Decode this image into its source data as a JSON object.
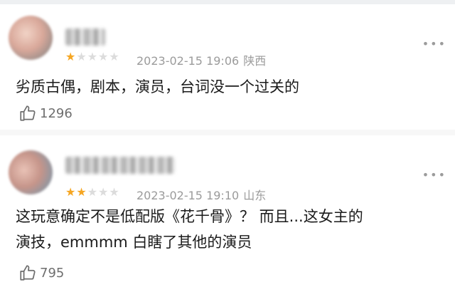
{
  "comments": [
    {
      "username": "",
      "username_fragment": "Ⅰ",
      "rating": 1,
      "max_rating": 5,
      "date": "2023-02-15 19:06",
      "location": "陕西",
      "content_line1": "劣质古偶，剧本，演员，台词没一个过关的",
      "content_line2": "",
      "likes": "1296",
      "more_label": "•••"
    },
    {
      "username": "",
      "rating": 2,
      "max_rating": 5,
      "date": "2023-02-15 19:10",
      "location": "山东",
      "content_line1": "这玩意确定不是低配版《花千骨》？ 而且...这女主的",
      "content_line2": "演技，emmmm 白瞎了其他的演员",
      "likes": "795",
      "more_label": "•••"
    }
  ],
  "colors": {
    "star_on": "#f5a623",
    "star_off": "#dcdcdc",
    "meta": "#9b9b9b"
  },
  "icons": {
    "like": "thumbs-up-icon",
    "more": "more-dots-icon"
  }
}
